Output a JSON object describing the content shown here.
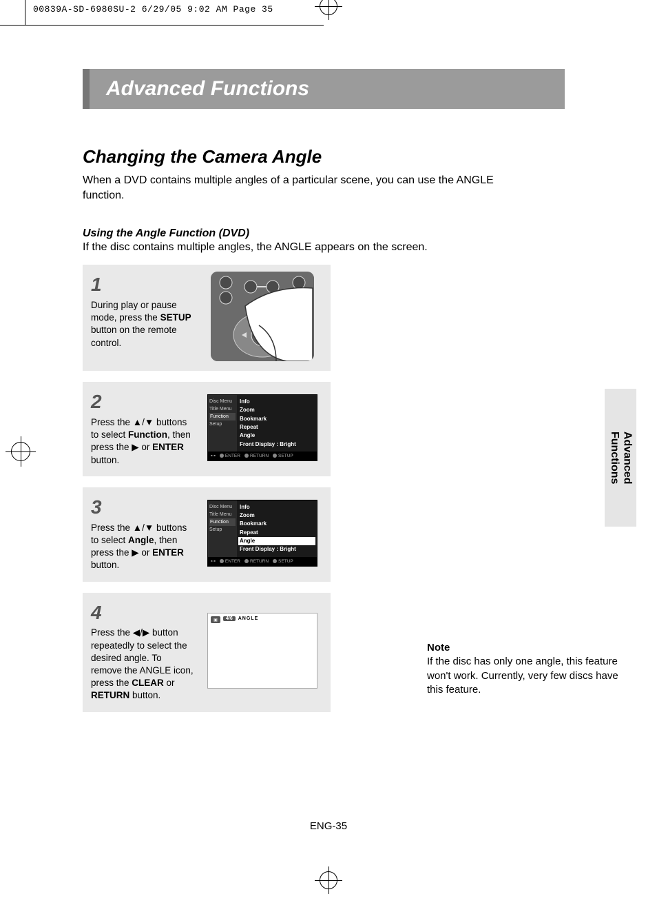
{
  "printline": "00839A-SD-6980SU-2  6/29/05  9:02 AM  Page 35",
  "banner": "Advanced Functions",
  "h2": "Changing the Camera Angle",
  "intro": "When a DVD contains multiple angles of a particular scene, you can use the ANGLE function.",
  "h3": "Using the Angle Function (DVD)",
  "sub": "If the disc contains multiple angles, the ANGLE appears on the screen.",
  "steps": {
    "s1": {
      "num": "1",
      "t1": "During play or pause mode, press the ",
      "b1": "SETUP",
      "t2": " button on the remote control."
    },
    "s2": {
      "num": "2",
      "t1": "Press the ▲/▼ buttons to select ",
      "b1": "Function",
      "t2": ", then press the ▶ or ",
      "b2": "ENTER",
      "t3": " button."
    },
    "s3": {
      "num": "3",
      "t1": "Press the ▲/▼ buttons to select ",
      "b1": "Angle",
      "t2": ", then press the ▶ or ",
      "b2": "ENTER",
      "t3": " button."
    },
    "s4": {
      "num": "4",
      "t1": "Press the ◀/▶ button repeatedly to select the desired angle. To remove the ANGLE icon, press the ",
      "b1": "CLEAR",
      "t2": " or ",
      "b2": "RETURN",
      "t3": " button."
    }
  },
  "osd": {
    "side": {
      "disc": "Disc Menu",
      "title": "Title Menu",
      "func": "Function",
      "setup": "Setup"
    },
    "items": {
      "info": "Info",
      "zoom": "Zoom",
      "bookmark": "Bookmark",
      "repeat": "Repeat",
      "angle": "Angle",
      "front": "Front Display : Bright"
    },
    "foot": {
      "enter": "ENTER",
      "return": "RETURN",
      "setup": "SETUP"
    }
  },
  "angle_bar": {
    "val": "4/6",
    "label": "ANGLE"
  },
  "note": {
    "h": "Note",
    "body": "If the disc has only one angle, this feature won't work. Currently, very few discs have this feature."
  },
  "side_tab": {
    "l1": "Advanced",
    "l2": "Functions"
  },
  "pagefoot": "ENG-35"
}
